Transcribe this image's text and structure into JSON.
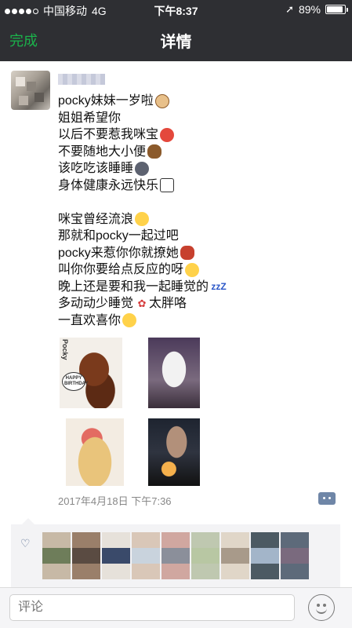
{
  "status_bar": {
    "carrier": "中国移动",
    "network": "4G",
    "time": "下午8:37",
    "battery_percent": "89%",
    "battery_level": 0.89
  },
  "nav": {
    "done_label": "完成",
    "title": "详情"
  },
  "post": {
    "lines": [
      {
        "text": "pocky妹妹一岁啦",
        "emoji": "dog-icon"
      },
      {
        "text": "姐姐希望你",
        "emoji": ""
      },
      {
        "text": "以后不要惹我咪宝",
        "emoji": "angry-face-icon"
      },
      {
        "text": "不要随地大小便",
        "emoji": "poop-icon"
      },
      {
        "text": "该吃吃该睡睡",
        "emoji": "new-moon-face-icon"
      },
      {
        "text": "身体健康永远快乐",
        "emoji": "framed-picture-icon"
      },
      {
        "text": "",
        "emoji": ""
      },
      {
        "text": "咪宝曾经流浪",
        "emoji": "crying-face-icon"
      },
      {
        "text": "那就和pocky一起过吧",
        "emoji": ""
      },
      {
        "text": "pocky来惹你你就撩她",
        "emoji": "devil-mask-icon"
      },
      {
        "text": "叫你你要给点反应的呀",
        "emoji": "no-mouth-face-icon"
      },
      {
        "text": "晚上还是要和我一起睡觉的",
        "emoji": "zzz-icon"
      },
      {
        "text": "多动动少睡觉",
        "emoji": "paw-prints-icon",
        "tail": "太胖咯"
      },
      {
        "text": "一直欢喜你",
        "emoji": "kissing-face-icon"
      }
    ],
    "photo_caption": "Pocky",
    "photo_card_text": "HAPPY BIRTHDAY",
    "timestamp": "2017年4月18日 下午7:36"
  },
  "comment_bar": {
    "placeholder": "评论"
  },
  "colors": {
    "accent_green": "#1bb24b",
    "topbar": "#2e2f33",
    "link_blue": "#5a6f93"
  }
}
